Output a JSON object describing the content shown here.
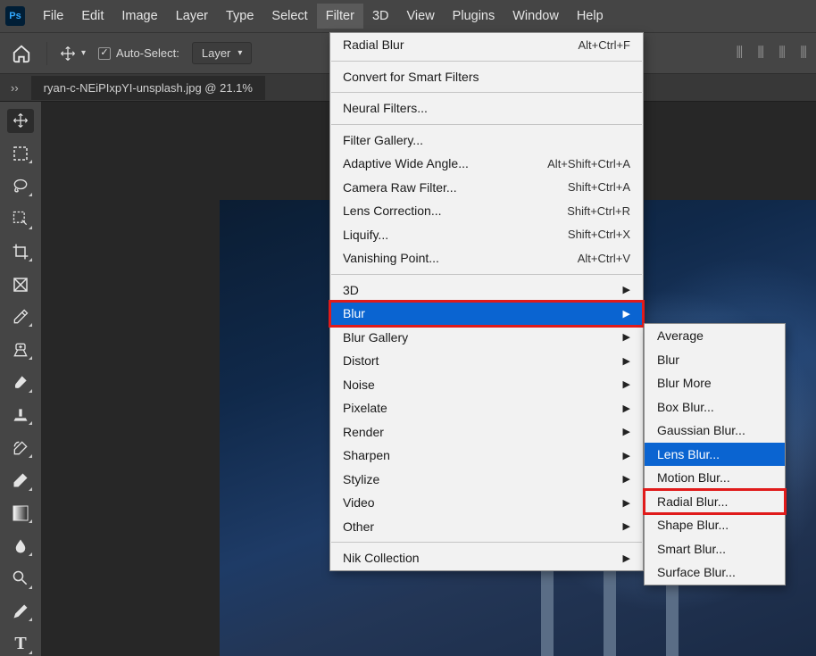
{
  "menubar": {
    "items": [
      "File",
      "Edit",
      "Image",
      "Layer",
      "Type",
      "Select",
      "Filter",
      "3D",
      "View",
      "Plugins",
      "Window",
      "Help"
    ],
    "active_index": 6
  },
  "optionsbar": {
    "auto_select_label": "Auto-Select:",
    "layer_dropdown": "Layer"
  },
  "document_tab": "ryan-c-NEiPIxpYI-unsplash.jpg @ 21.1%",
  "filter_menu": {
    "last_filter": {
      "label": "Radial Blur",
      "shortcut": "Alt+Ctrl+F"
    },
    "smart": "Convert for Smart Filters",
    "neural": "Neural Filters...",
    "group_gallery": [
      {
        "label": "Filter Gallery...",
        "shortcut": ""
      },
      {
        "label": "Adaptive Wide Angle...",
        "shortcut": "Alt+Shift+Ctrl+A"
      },
      {
        "label": "Camera Raw Filter...",
        "shortcut": "Shift+Ctrl+A"
      },
      {
        "label": "Lens Correction...",
        "shortcut": "Shift+Ctrl+R"
      },
      {
        "label": "Liquify...",
        "shortcut": "Shift+Ctrl+X"
      },
      {
        "label": "Vanishing Point...",
        "shortcut": "Alt+Ctrl+V"
      }
    ],
    "group_sub": [
      "3D",
      "Blur",
      "Blur Gallery",
      "Distort",
      "Noise",
      "Pixelate",
      "Render",
      "Sharpen",
      "Stylize",
      "Video",
      "Other"
    ],
    "nik": "Nik Collection",
    "highlighted_sub_index": 1
  },
  "blur_submenu": {
    "items": [
      "Average",
      "Blur",
      "Blur More",
      "Box Blur...",
      "Gaussian Blur...",
      "Lens Blur...",
      "Motion Blur...",
      "Radial Blur...",
      "Shape Blur...",
      "Smart Blur...",
      "Surface Blur..."
    ],
    "highlighted_index": 5,
    "red_index": 7
  }
}
